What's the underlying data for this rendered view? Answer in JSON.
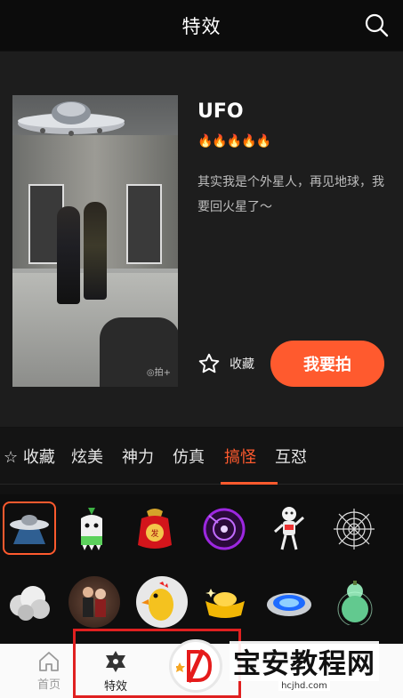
{
  "header": {
    "title": "特效",
    "search_icon": "search-icon"
  },
  "featured": {
    "name": "UFO",
    "rating": "🔥🔥🔥🔥🔥",
    "description": "其实我是个外星人，再见地球，我要回火星了～",
    "favorite_label": "收藏",
    "shoot_label": "我要拍",
    "watermark": "◎拍+",
    "accent_color": "#ff5a2e"
  },
  "categories": [
    {
      "label": "☆ 收藏"
    },
    {
      "label": "炫美"
    },
    {
      "label": "神力"
    },
    {
      "label": "仿真"
    },
    {
      "label": "搞怪",
      "active": true
    },
    {
      "label": "互怼"
    }
  ],
  "effects": [
    {
      "icon": "ufo-icon",
      "selected": true
    },
    {
      "icon": "radish-ghost-icon"
    },
    {
      "icon": "red-envelope-bag-icon"
    },
    {
      "icon": "purple-disc-icon"
    },
    {
      "icon": "dancing-robot-icon"
    },
    {
      "icon": "spider-web-icon"
    },
    {
      "icon": "smoke-cloud-icon"
    },
    {
      "icon": "dancers-photo-icon"
    },
    {
      "icon": "rubber-chicken-icon"
    },
    {
      "icon": "gold-ingot-icon"
    },
    {
      "icon": "blue-portal-icon"
    },
    {
      "icon": "green-gourd-icon"
    }
  ],
  "bottom_nav": [
    {
      "label": "首页",
      "icon": "home-icon"
    },
    {
      "label": "特效",
      "icon": "star-of-david-icon",
      "active": true
    }
  ],
  "overlay": {
    "site_name": "宝安教程网",
    "site_url": "hcjhd.com"
  }
}
